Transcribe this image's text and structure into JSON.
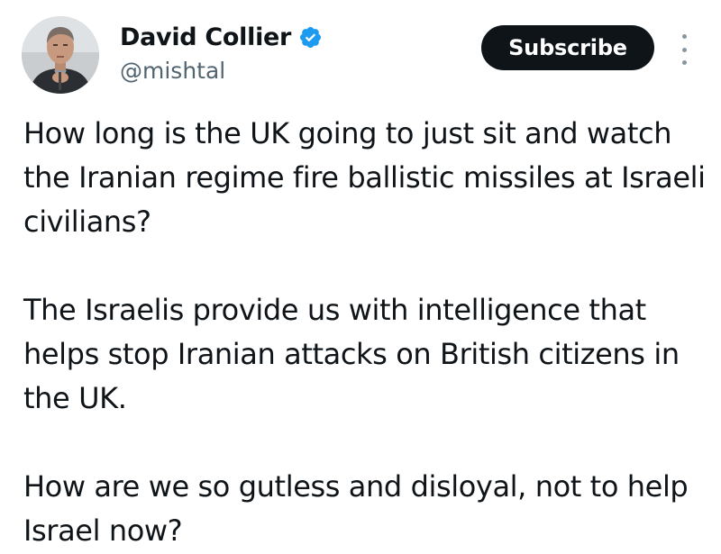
{
  "author": {
    "display_name": "David Collier",
    "handle": "@mishtal",
    "verified_icon": "verified-badge-icon",
    "badge_color": "#1d9bf0"
  },
  "actions": {
    "subscribe_label": "Subscribe",
    "more_icon": "more-vertical-icon"
  },
  "tweet": {
    "paragraphs": [
      "How long is the UK going to just sit and watch the Iranian regime fire ballistic missiles at Israeli civilians?",
      "The Israelis provide us with intelligence that helps stop Iranian attacks on British citizens in the UK.",
      "How are we so gutless and disloyal, not to help Israel now?"
    ]
  },
  "colors": {
    "text": "#0f1419",
    "secondary_text": "#536471",
    "button_bg": "#0f1419",
    "button_text": "#ffffff"
  }
}
